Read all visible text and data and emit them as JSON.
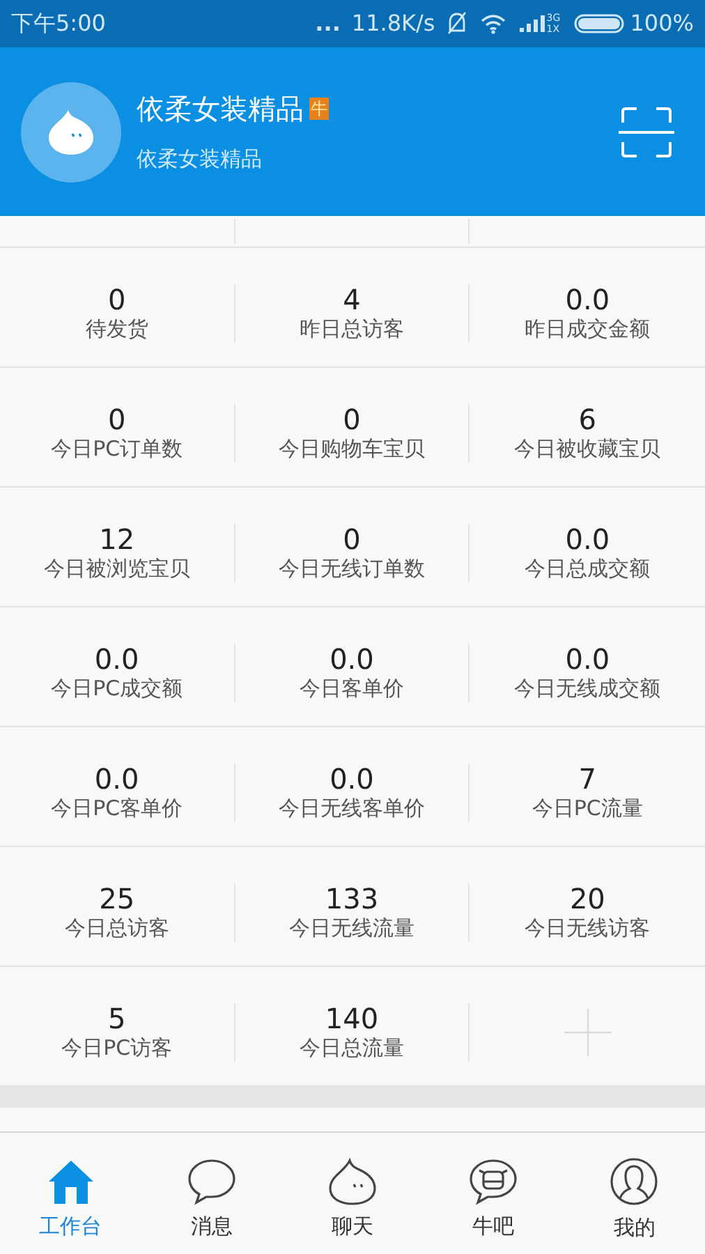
{
  "status_bar": {
    "time": "下午5:00",
    "dots": "...",
    "speed": "11.8K/s",
    "network": "3G 1X",
    "battery": "100%"
  },
  "header": {
    "title": "依柔女装精品",
    "badge": "牛",
    "subtitle": "依柔女装精品"
  },
  "stats": [
    {
      "value": "0",
      "label": "待发货"
    },
    {
      "value": "4",
      "label": "昨日总访客"
    },
    {
      "value": "0.0",
      "label": "昨日成交金额"
    },
    {
      "value": "0",
      "label": "今日PC订单数"
    },
    {
      "value": "0",
      "label": "今日购物车宝贝"
    },
    {
      "value": "6",
      "label": "今日被收藏宝贝"
    },
    {
      "value": "12",
      "label": "今日被浏览宝贝"
    },
    {
      "value": "0",
      "label": "今日无线订单数"
    },
    {
      "value": "0.0",
      "label": "今日总成交额"
    },
    {
      "value": "0.0",
      "label": "今日PC成交额"
    },
    {
      "value": "0.0",
      "label": "今日客单价"
    },
    {
      "value": "0.0",
      "label": "今日无线成交额"
    },
    {
      "value": "0.0",
      "label": "今日PC客单价"
    },
    {
      "value": "0.0",
      "label": "今日无线客单价"
    },
    {
      "value": "7",
      "label": "今日PC流量"
    },
    {
      "value": "25",
      "label": "今日总访客"
    },
    {
      "value": "133",
      "label": "今日无线流量"
    },
    {
      "value": "20",
      "label": "今日无线访客"
    },
    {
      "value": "5",
      "label": "今日PC访客"
    },
    {
      "value": "140",
      "label": "今日总流量"
    }
  ],
  "tabs": [
    {
      "kind": "home",
      "label": "工作台",
      "selected": true
    },
    {
      "kind": "message",
      "label": "消息",
      "selected": false
    },
    {
      "kind": "chat",
      "label": "聊天",
      "selected": false
    },
    {
      "kind": "cow",
      "label": "牛吧",
      "selected": false
    },
    {
      "kind": "user",
      "label": "我的",
      "selected": false
    }
  ]
}
